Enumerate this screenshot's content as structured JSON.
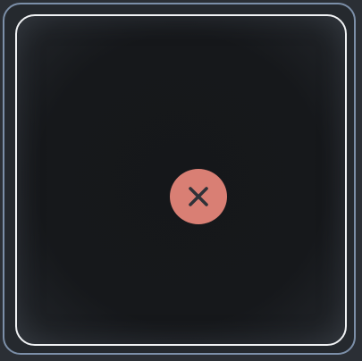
{
  "tile": {
    "accent_color": "#d97f74",
    "border_color": "#f1f3f5",
    "frame_color": "#7c8fa8",
    "background_color": "#16181b"
  },
  "close_button": {
    "icon": "close-icon"
  }
}
